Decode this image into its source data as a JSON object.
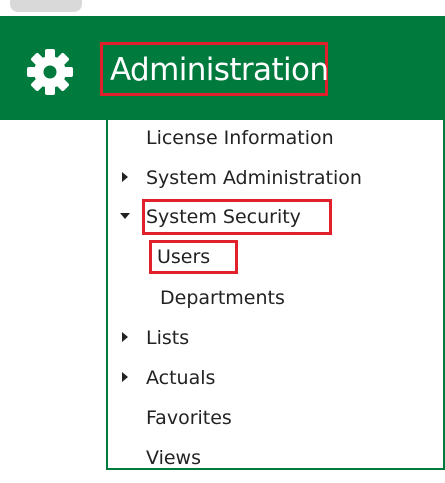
{
  "header": {
    "title": "Administration",
    "icon": "gear-icon",
    "background_color": "#007a3d",
    "highlight_color": "#e0202b"
  },
  "menu": {
    "items": [
      {
        "label": "License Information",
        "expander": "none"
      },
      {
        "label": "System Administration",
        "expander": "collapsed"
      },
      {
        "label": "System Security",
        "expander": "expanded",
        "highlighted": true,
        "children": [
          {
            "label": "Users",
            "highlighted": true
          },
          {
            "label": "Departments"
          }
        ]
      },
      {
        "label": "Lists",
        "expander": "collapsed"
      },
      {
        "label": "Actuals",
        "expander": "collapsed"
      },
      {
        "label": "Favorites",
        "expander": "none"
      },
      {
        "label": "Views",
        "expander": "none"
      }
    ]
  }
}
